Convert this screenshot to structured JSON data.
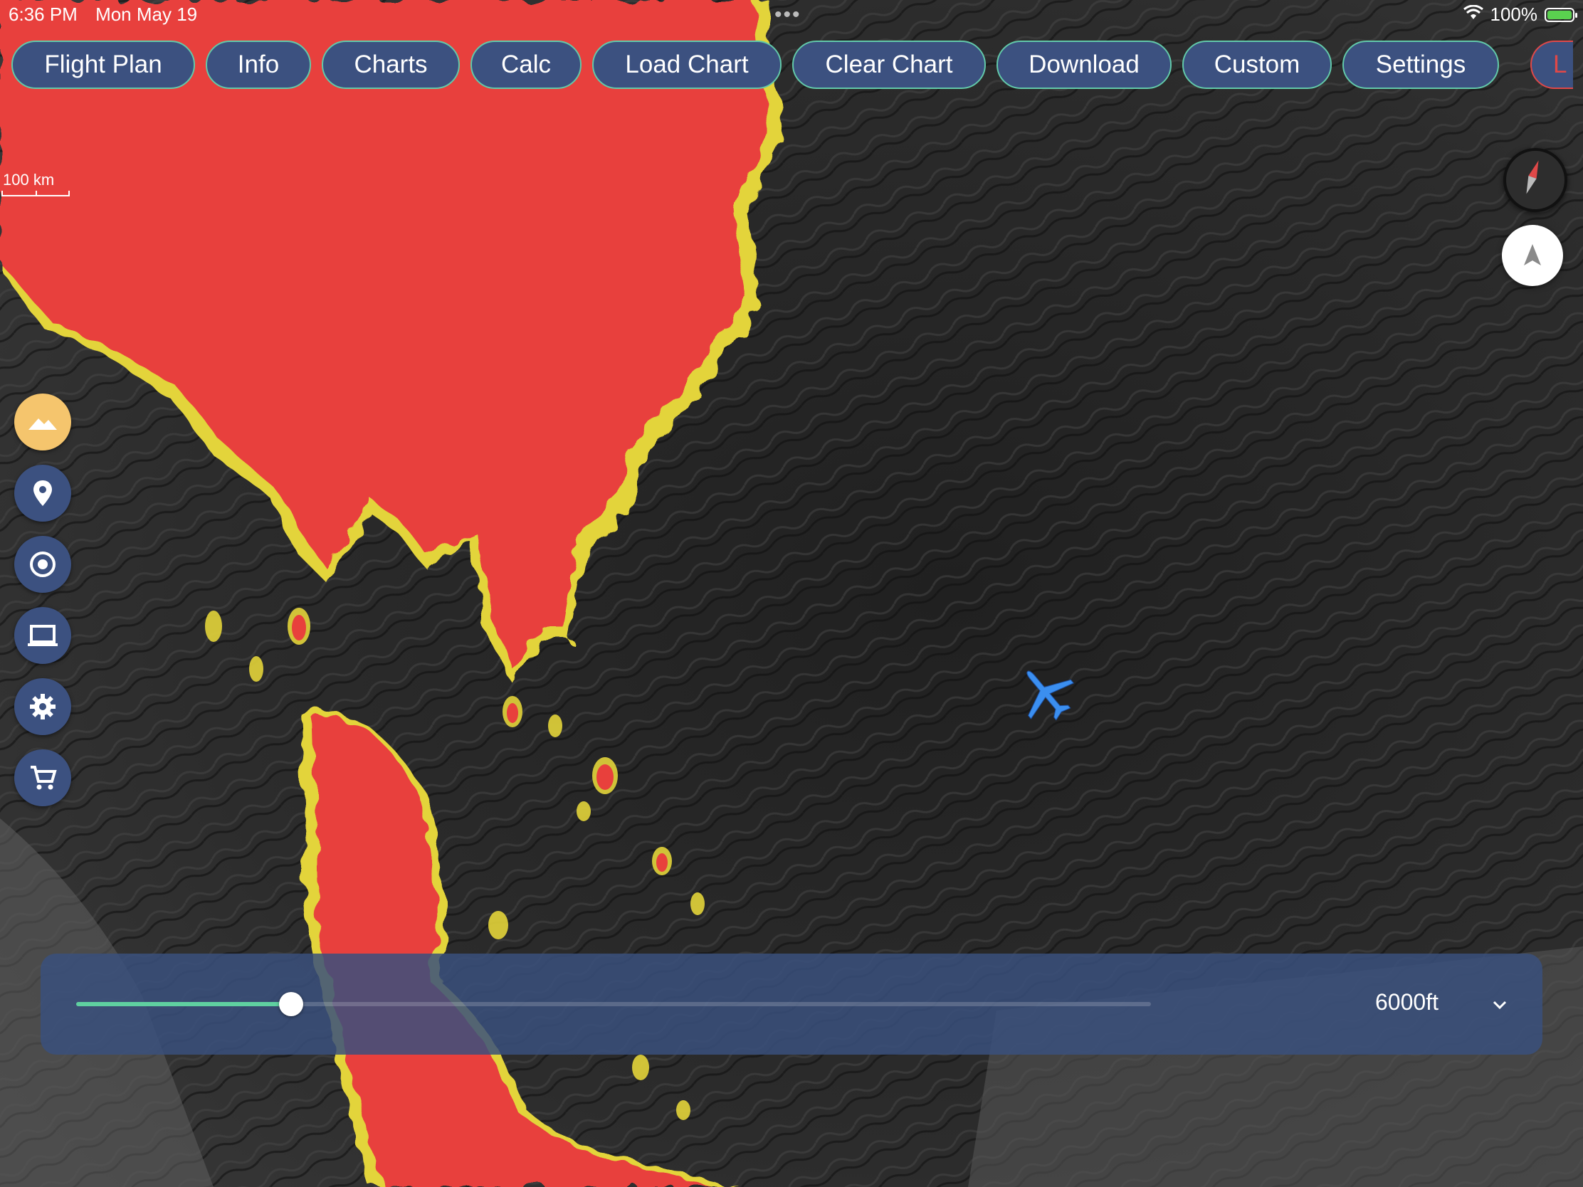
{
  "status_bar": {
    "time": "6:36 PM",
    "date": "Mon May 19",
    "multitask_dots": "•••",
    "battery_pct": "100%"
  },
  "toolbar": {
    "buttons": [
      "Flight Plan",
      "Info",
      "Charts",
      "Calc",
      "Load Chart",
      "Clear Chart",
      "Download",
      "Custom",
      "Settings"
    ],
    "partial_button": "L"
  },
  "map": {
    "scale_label": "100 km",
    "terrain_warning_color": "#e8403c",
    "terrain_caution_color": "#e3d43a",
    "aircraft_color": "#3b8ff0"
  },
  "side_buttons": [
    "terrain-icon",
    "map-pin-icon",
    "target-icon",
    "laptop-icon",
    "gear-icon",
    "cart-icon"
  ],
  "altitude": {
    "value_label": "6000ft",
    "slider_fraction": 0.2
  },
  "colors": {
    "button_bg": "#3c5180",
    "button_border": "#62c9a9",
    "active_side": "#f5c56d"
  }
}
